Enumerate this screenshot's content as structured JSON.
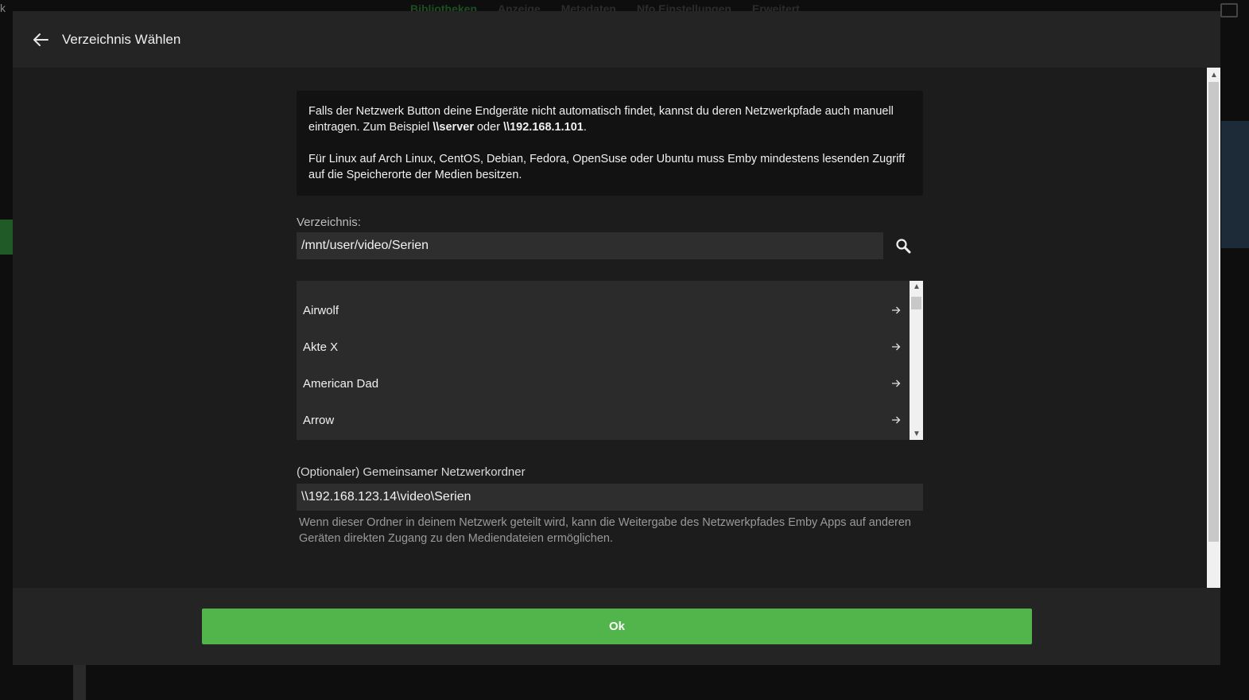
{
  "background": {
    "k_letter": "k",
    "tabs": [
      "Bibliotheken",
      "Anzeige",
      "Metadaten",
      "Nfo Einstellungen",
      "Erweitert"
    ]
  },
  "dialog": {
    "title": "Verzeichnis Wählen",
    "back_icon": "arrow-left-icon",
    "info": {
      "p1_before": "Falls der Netzwerk Button deine Endgeräte nicht automatisch findet, kannst du deren Netzwerkpfade auch manuell eintragen. Zum Beispiel ",
      "p1_example1": "\\\\server",
      "p1_mid": " oder ",
      "p1_example2": "\\\\192.168.1.101",
      "p1_end": ".",
      "p2": "Für Linux auf Arch Linux, CentOS, Debian, Fedora, OpenSuse oder Ubuntu muss Emby mindestens lesenden Zugriff auf die Speicherorte der Medien besitzen."
    },
    "directory": {
      "label": "Verzeichnis:",
      "value": "/mnt/user/video/Serien",
      "search_icon": "search-icon"
    },
    "folders": [
      "Airwolf",
      "Akte X",
      "American Dad",
      "Arrow"
    ],
    "share": {
      "label": "(Optionaler) Gemeinsamer Netzwerkordner",
      "value": "\\\\192.168.123.14\\video\\Serien",
      "help": "Wenn dieser Ordner in deinem Netzwerk geteilt wird, kann die Weitergabe des Netzwerkpfades Emby Apps auf anderen Geräten direkten Zugang zu den Mediendateien ermöglichen."
    },
    "ok_label": "Ok"
  },
  "colors": {
    "accent": "#52b54b",
    "dialog_bg": "#1c1c1c",
    "header_bg": "#242424",
    "input_bg": "#2e2e2e"
  }
}
